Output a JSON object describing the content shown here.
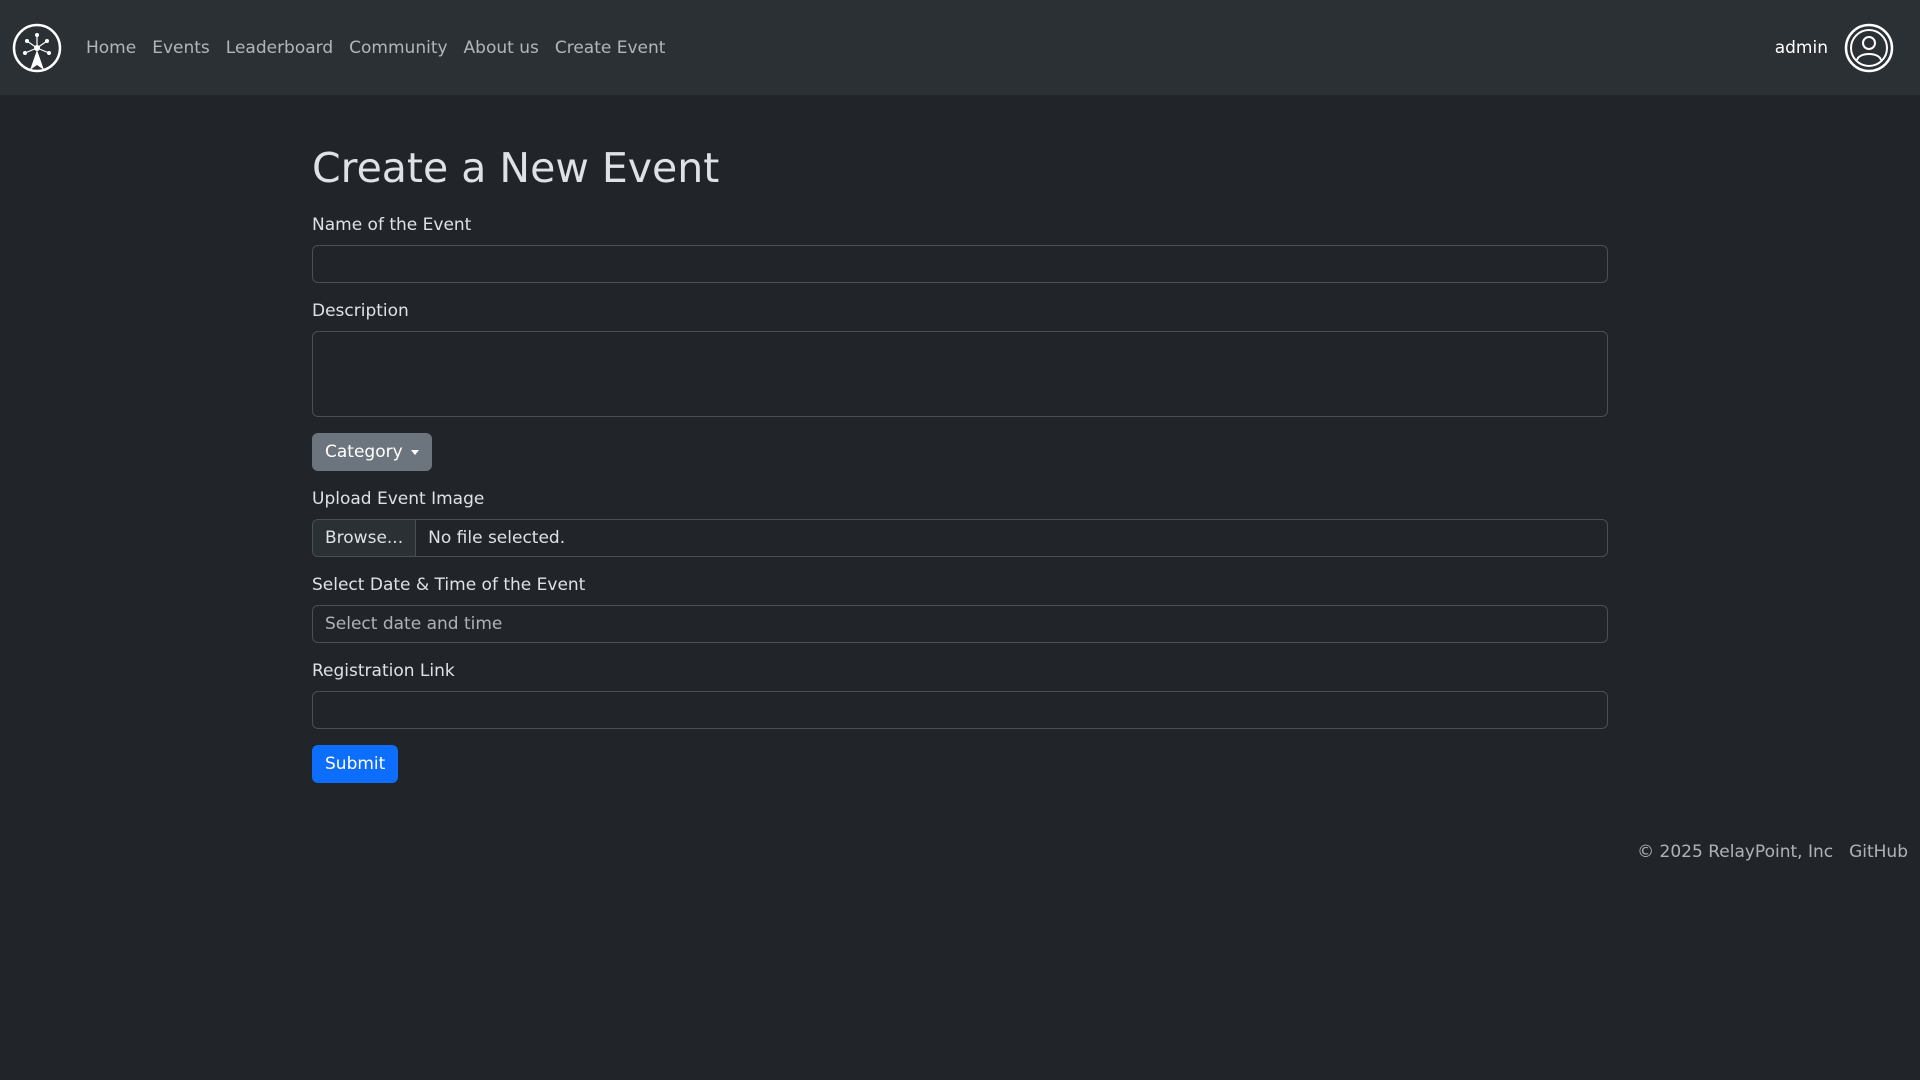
{
  "nav": {
    "brand_icon": "relay-logo-icon",
    "links": [
      "Home",
      "Events",
      "Leaderboard",
      "Community",
      "About us",
      "Create Event"
    ],
    "username": "admin",
    "avatar_icon": "user-circle-icon"
  },
  "form": {
    "title": "Create a New Event",
    "name_label": "Name of the Event",
    "name_value": "",
    "description_label": "Description",
    "description_value": "",
    "category_button": "Category",
    "upload_label": "Upload Event Image",
    "browse_button": "Browse...",
    "file_status": "No file selected.",
    "datetime_label": "Select Date & Time of the Event",
    "datetime_placeholder": "Select date and time",
    "registration_label": "Registration Link",
    "registration_value": "",
    "submit_button": "Submit"
  },
  "footer": {
    "copyright": "© 2025 RelayPoint, Inc",
    "github_link": "GitHub"
  },
  "colors": {
    "background": "#212529",
    "navbar": "#2b3035",
    "primary": "#0d6efd",
    "secondary": "#6c757d"
  }
}
